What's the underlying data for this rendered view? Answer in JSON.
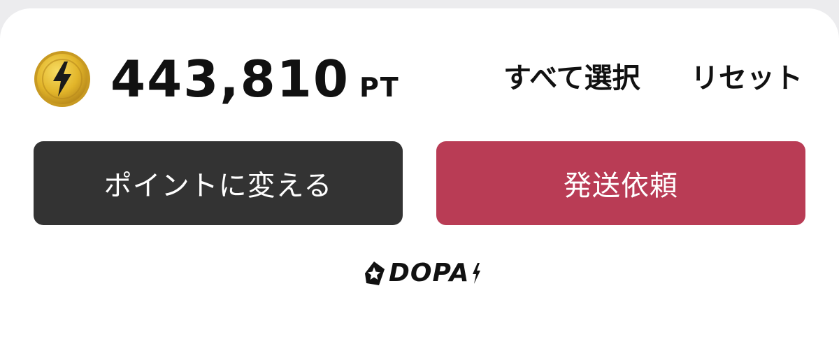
{
  "balance": {
    "value": "443,810",
    "unit": "PT",
    "icon": "lightning-coin-icon"
  },
  "actions": {
    "select_all": "すべて選択",
    "reset": "リセット"
  },
  "buttons": {
    "convert_label": "ポイントに変える",
    "ship_label": "発送依頼"
  },
  "logo": {
    "text": "DOPA"
  },
  "colors": {
    "convert_button": "#333333",
    "ship_button": "#b93c55",
    "coin_gold": "#e2b52a",
    "text": "#111111"
  }
}
